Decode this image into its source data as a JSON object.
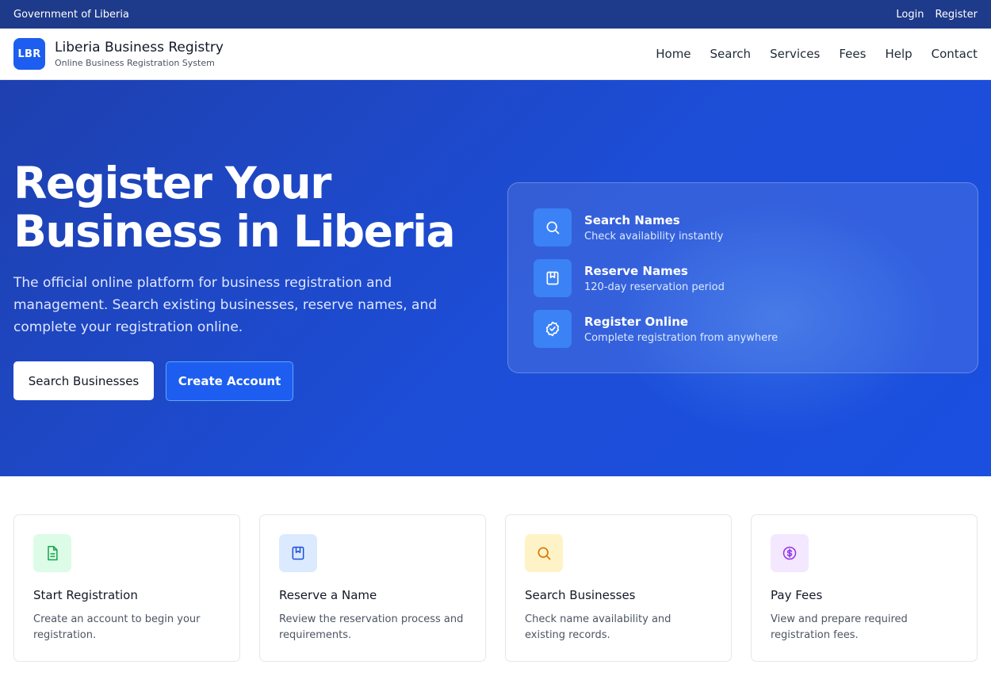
{
  "topbar": {
    "org": "Government of Liberia",
    "login": "Login",
    "register": "Register"
  },
  "brand": {
    "logo": "LBR",
    "title": "Liberia Business Registry",
    "subtitle": "Online Business Registration System"
  },
  "nav": [
    "Home",
    "Search",
    "Services",
    "Fees",
    "Help",
    "Contact"
  ],
  "hero": {
    "title_line1": "Register Your",
    "title_line2": "Business in Liberia",
    "text": "The official online platform for business registration and management. Search existing businesses, reserve names, and complete your registration online.",
    "btn_search": "Search Businesses",
    "btn_create": "Create Account"
  },
  "features": [
    {
      "title": "Search Names",
      "desc": "Check availability instantly",
      "icon": "search-icon"
    },
    {
      "title": "Reserve Names",
      "desc": "120-day reservation period",
      "icon": "bookmark-icon"
    },
    {
      "title": "Register Online",
      "desc": "Complete registration from anywhere",
      "icon": "check-badge-icon"
    }
  ],
  "cards": [
    {
      "title": "Start Registration",
      "desc": "Create an account to begin your registration.",
      "icon": "document-icon",
      "bg": "#dcfce7",
      "color": "#16a34a"
    },
    {
      "title": "Reserve a Name",
      "desc": "Review the reservation process and requirements.",
      "icon": "bookmark-icon",
      "bg": "#dbeafe",
      "color": "#1d4ed8"
    },
    {
      "title": "Search Businesses",
      "desc": "Check name availability and existing records.",
      "icon": "search-icon",
      "bg": "#fef3c7",
      "color": "#d97706"
    },
    {
      "title": "Pay Fees",
      "desc": "View and prepare required registration fees.",
      "icon": "dollar-icon",
      "bg": "#f3e8ff",
      "color": "#9333ea"
    }
  ],
  "colors": {
    "topbar": "#1e3a8a",
    "hero": "#1d4ed8",
    "accent": "#1d5ef0"
  }
}
